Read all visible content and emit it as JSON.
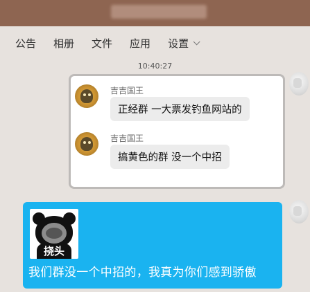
{
  "title_bar": {
    "title": ""
  },
  "tabs": [
    {
      "label": "公告"
    },
    {
      "label": "相册"
    },
    {
      "label": "文件"
    },
    {
      "label": "应用"
    },
    {
      "label": "设置"
    }
  ],
  "timestamp": "10:40:27",
  "forwarded_messages": [
    {
      "sender": "吉吉国王",
      "text": "正经群 一大票发钓鱼网站的"
    },
    {
      "sender": "吉吉国王",
      "text": "搞黄色的群 没一个中招"
    }
  ],
  "reply": {
    "sticker_text": "挠头",
    "text": "我们群没一个中招的，我真为你们感到骄傲",
    "bubble_color": "#1ab3f0"
  },
  "colors": {
    "title_bar": "#8e6551",
    "background": "#e7e2de"
  }
}
